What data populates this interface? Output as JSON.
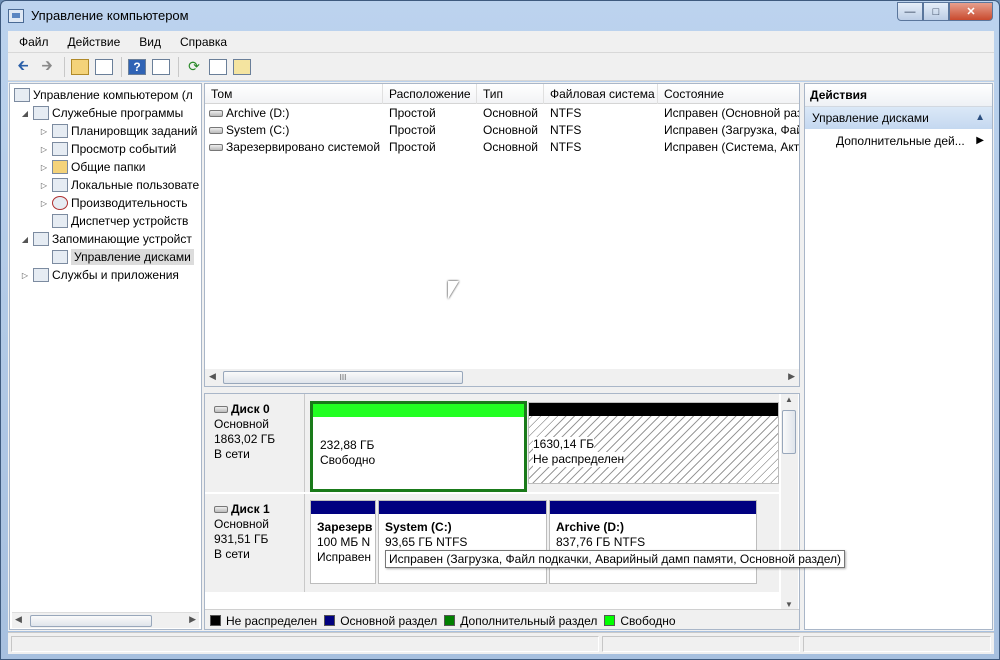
{
  "window": {
    "title": "Управление компьютером"
  },
  "menu": [
    "Файл",
    "Действие",
    "Вид",
    "Справка"
  ],
  "toolbar": [
    "back-arrow-icon",
    "forward-arrow-icon",
    "folder-up-icon",
    "show-hide-tree-icon",
    "help-icon",
    "panel-icon",
    "refresh-icon",
    "properties-icon",
    "export-icon"
  ],
  "tree": {
    "root": "Управление компьютером (л",
    "items": [
      {
        "label": "Служебные программы",
        "level": 1,
        "expanded": true
      },
      {
        "label": "Планировщик заданий",
        "level": 2
      },
      {
        "label": "Просмотр событий",
        "level": 2
      },
      {
        "label": "Общие папки",
        "level": 2
      },
      {
        "label": "Локальные пользовате",
        "level": 2
      },
      {
        "label": "Производительность",
        "level": 2
      },
      {
        "label": "Диспетчер устройств",
        "level": 2
      },
      {
        "label": "Запоминающие устройст",
        "level": 1,
        "expanded": true
      },
      {
        "label": "Управление дисками",
        "level": 2,
        "selected": true
      },
      {
        "label": "Службы и приложения",
        "level": 1
      }
    ]
  },
  "volumes": {
    "columns": [
      "Том",
      "Расположение",
      "Тип",
      "Файловая система",
      "Состояние"
    ],
    "rows": [
      [
        "Archive (D:)",
        "Простой",
        "Основной",
        "NTFS",
        "Исправен (Основной раз"
      ],
      [
        "System (C:)",
        "Простой",
        "Основной",
        "NTFS",
        "Исправен (Загрузка, Фай"
      ],
      [
        "Зарезервировано системой",
        "Простой",
        "Основной",
        "NTFS",
        "Исправен (Система, Акт"
      ]
    ],
    "hscroll_glyph": "III"
  },
  "disks": [
    {
      "name": "Диск 0",
      "type": "Основной",
      "size": "1863,02 ГБ",
      "state": "В сети",
      "partitions": [
        {
          "line1": "232,88 ГБ",
          "line2": "Свободно",
          "kind": "free"
        },
        {
          "line1": "1630,14 ГБ",
          "line2": "Не распределен",
          "kind": "unallocated"
        }
      ]
    },
    {
      "name": "Диск 1",
      "type": "Основной",
      "size": "931,51 ГБ",
      "state": "В сети",
      "partitions": [
        {
          "title": "Зарезерв",
          "line1": "100 МБ N",
          "line2": "Исправен",
          "kind": "primary"
        },
        {
          "title": "System  (C:)",
          "line1": "93,65 ГБ NTFS",
          "line2": "",
          "kind": "primary"
        },
        {
          "title": "Archive  (D:)",
          "line1": "837,76 ГБ NTFS",
          "line2": "",
          "kind": "primary"
        }
      ]
    }
  ],
  "tooltip": "Исправен (Загрузка, Файл подкачки, Аварийный дамп памяти, Основной раздел)",
  "legend": [
    {
      "label": "Не распределен",
      "color": "#000000"
    },
    {
      "label": "Основной раздел",
      "color": "#00007f"
    },
    {
      "label": "Дополнительный раздел",
      "color": "#007f00"
    },
    {
      "label": "Свободно",
      "color": "#00ff00"
    }
  ],
  "actions": {
    "title": "Действия",
    "section": "Управление дисками",
    "item": "Дополнительные дей..."
  }
}
